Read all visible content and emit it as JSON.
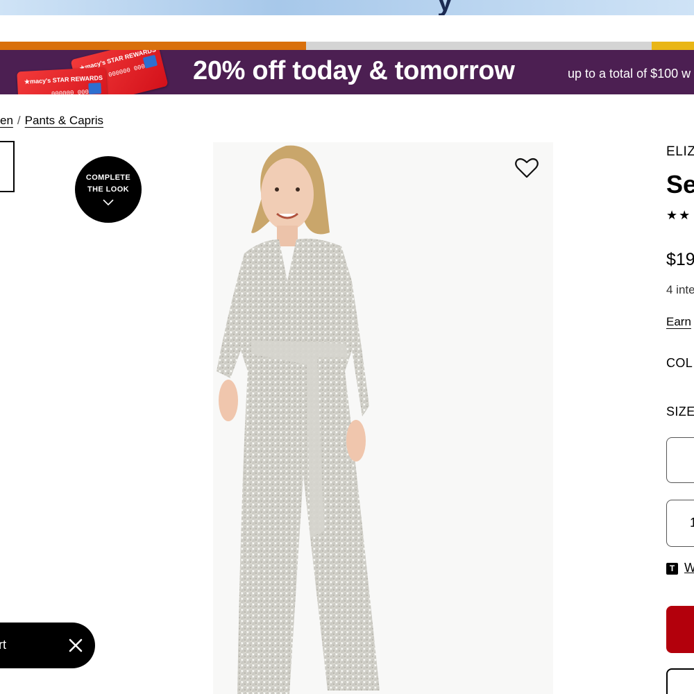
{
  "banner": {
    "headline": "20% off today & tomorrow",
    "subtext": "up to a total of $100 w",
    "card_label": "★macy's STAR REWARDS",
    "card_number": "000000 00000"
  },
  "breadcrumb": {
    "items": [
      "en",
      "Pants & Capris"
    ],
    "separator": "/"
  },
  "complete_look": {
    "line1": "COMPLETE",
    "line2": "THE LOOK"
  },
  "product": {
    "brand": "ELIZ",
    "title": "Se",
    "rating_stars": "★★",
    "price": "$19",
    "installments": "4 inte",
    "earn_link": "Earn",
    "color_label": "COL",
    "size_label": "SIZE",
    "quantity": "1",
    "t_badge": "T",
    "t_link": "W"
  },
  "toast": {
    "message": "ert"
  },
  "colors": {
    "promo_bg": "#4c1f52",
    "add_to_bag": "#b3000c",
    "stripe_orange": "#d9700c",
    "stripe_gray": "#d4d4d4",
    "stripe_yellow": "#e9b616"
  },
  "icons": [
    "heart-icon",
    "chevron-down-icon",
    "close-icon",
    "credit-card-icon"
  ]
}
